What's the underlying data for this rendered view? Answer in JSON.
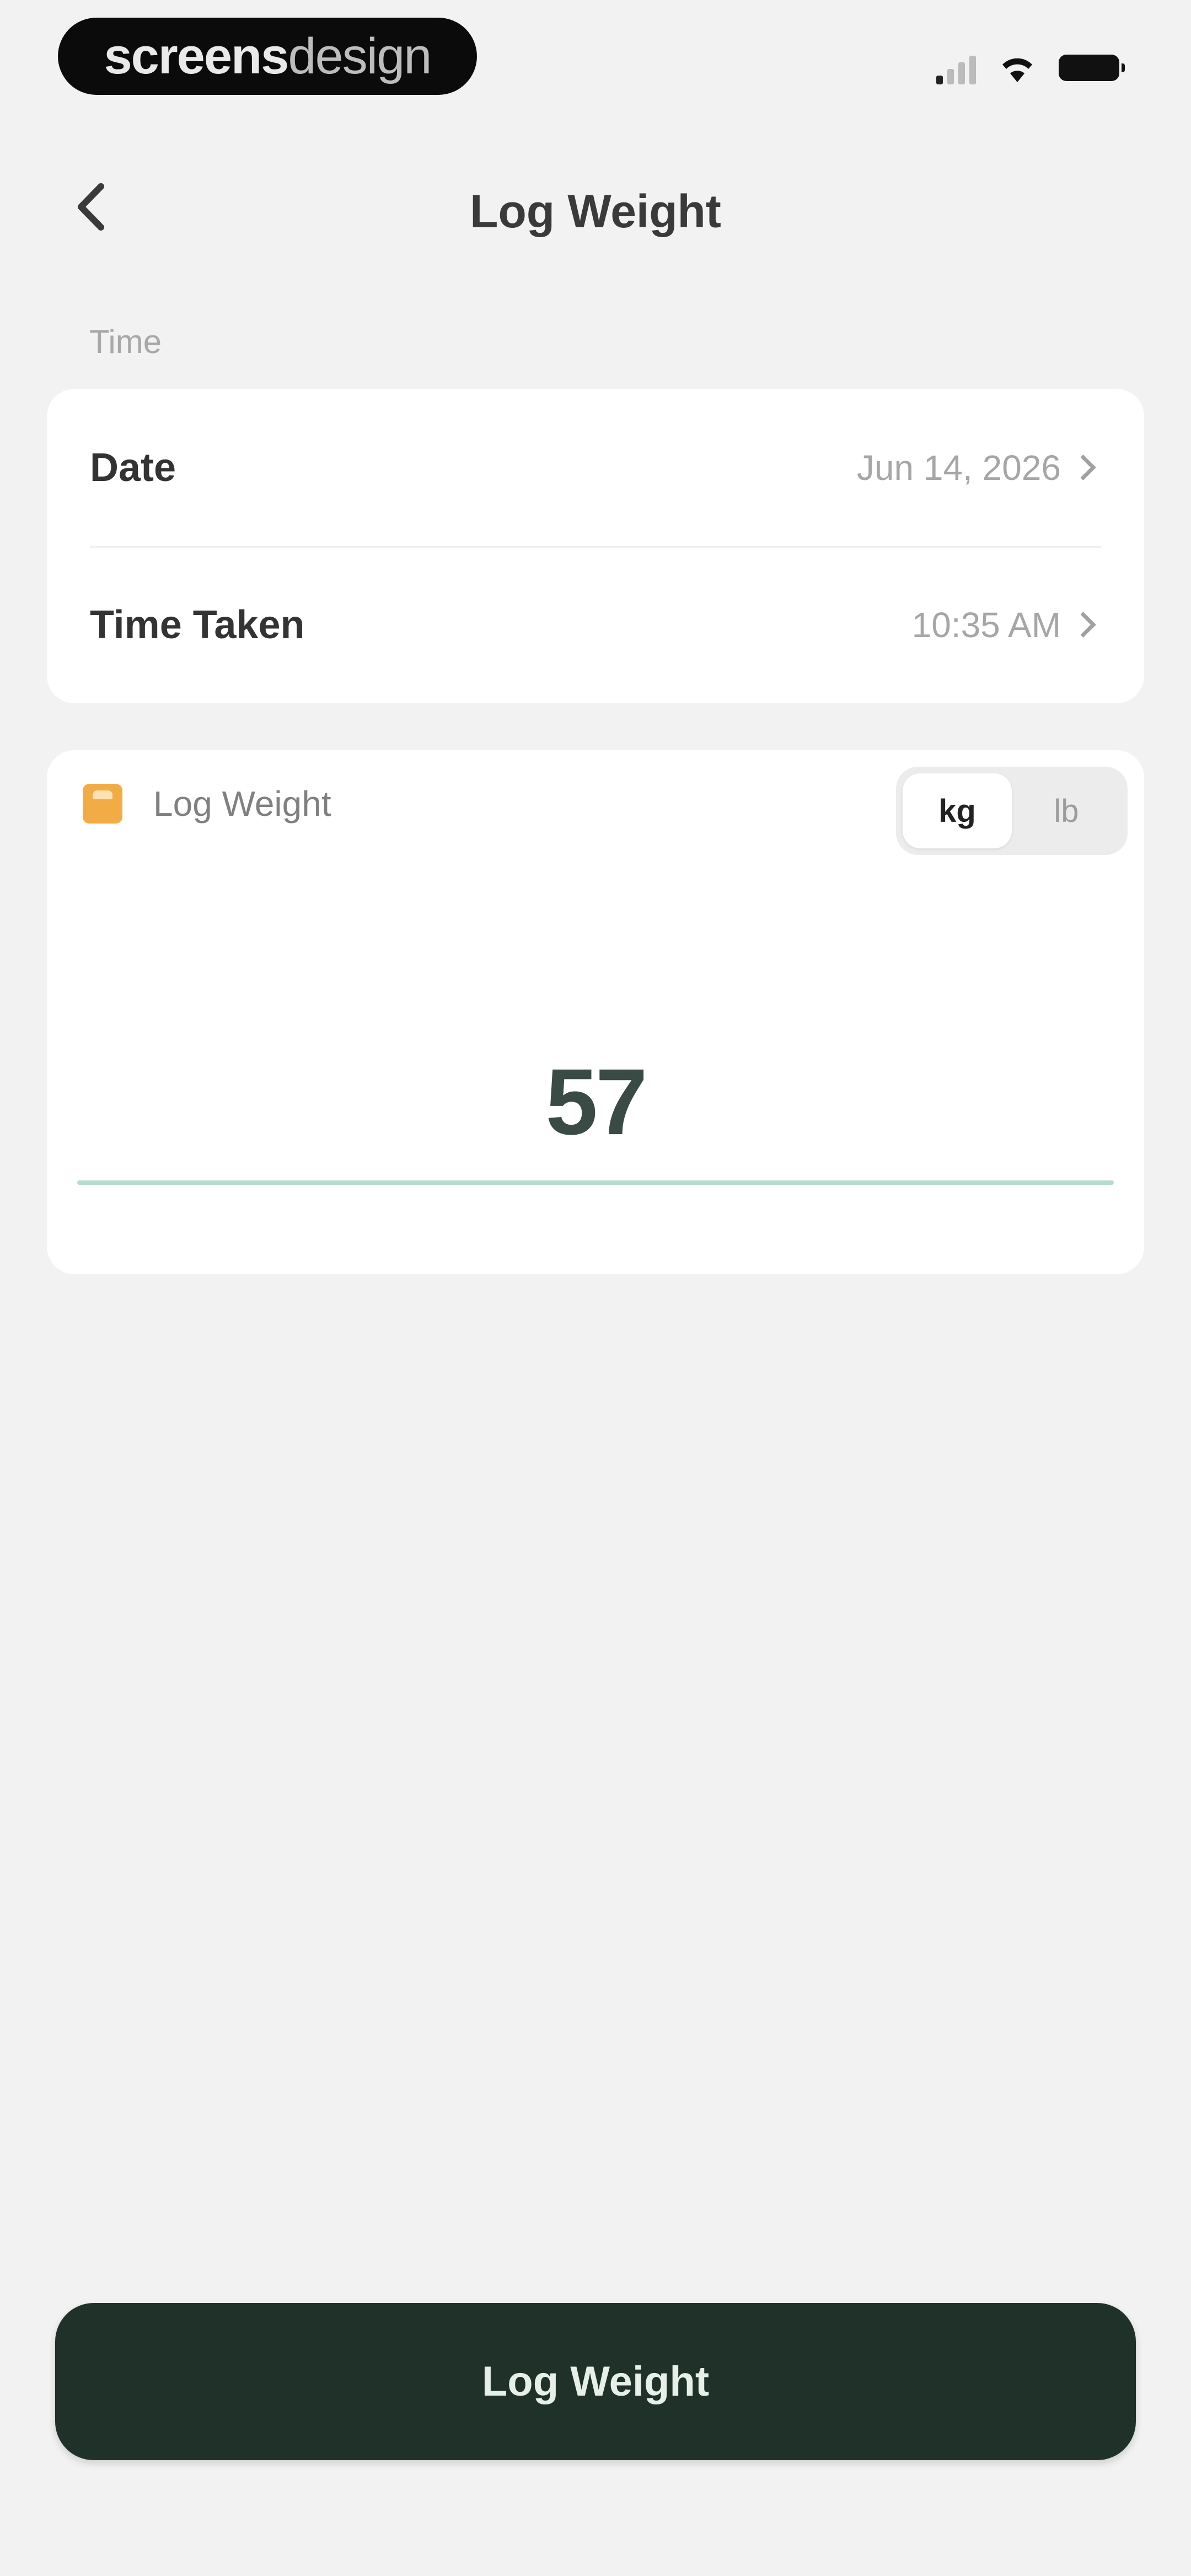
{
  "status_bar": {
    "watermark_bold": "screens",
    "watermark_light": "design"
  },
  "header": {
    "title": "Log Weight",
    "back_icon": "chevron-left-icon"
  },
  "time_section": {
    "label": "Time",
    "date_label": "Date",
    "date_value": "Jun 14, 2026",
    "time_label": "Time Taken",
    "time_value": "10:35 AM"
  },
  "weight_section": {
    "label": "Log Weight",
    "icon": "scale-icon",
    "icon_color": "#f2ac46",
    "units": [
      "kg",
      "lb"
    ],
    "selected_unit": "kg",
    "value": "57"
  },
  "actions": {
    "submit_label": "Log Weight"
  },
  "colors": {
    "primary_button": "#1f3129",
    "underline_accent": "#b7dccd",
    "background": "#f2f2f2"
  }
}
